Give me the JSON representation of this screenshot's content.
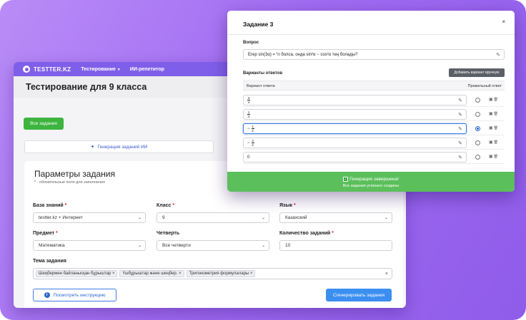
{
  "app": {
    "brand": "TESTTER.KZ",
    "nav": [
      {
        "label": "Тестирование",
        "has_caret": true
      },
      {
        "label": "ИИ-репетитор",
        "has_caret": false
      }
    ],
    "page_title": "Тестирование для 9 класса",
    "all_tasks_button": "Все задания",
    "ai_generation_tab": "Генерация заданий ИИ"
  },
  "params": {
    "title": "Параметры задания",
    "required_note": "* - обязательные поля для заполнения",
    "knowledge_base": {
      "label": "База знаний",
      "required": "*",
      "value": "testter.kz + Интернет"
    },
    "grade": {
      "label": "Класс",
      "required": "*",
      "value": "9"
    },
    "language": {
      "label": "Язык",
      "required": "*",
      "value": "Казахский"
    },
    "subject": {
      "label": "Предмет",
      "required": "*",
      "value": "Математика"
    },
    "quarter": {
      "label": "Четверть",
      "value": "Все четверти"
    },
    "count": {
      "label": "Количество заданий",
      "required": "*",
      "value": "10"
    },
    "topic": {
      "label": "Тема задания",
      "tags": [
        "Шеңбермен байланысқан бұрыштар",
        "Үшбұрыштар және шеңбер.",
        "Тригонометрия формулалары"
      ]
    },
    "instruction_button": "Посмотреть инструкцию",
    "generate_button": "Сгенерировать задания"
  },
  "modal": {
    "title": "Задание 3",
    "close": "×",
    "question_label": "Вопрос",
    "question_text": "Егер sin(3α) = ½ болса, онда sin²α − cos²α тең болады?",
    "answers_label": "Варианты ответов",
    "add_manual_button": "Добавить вариант вручную",
    "col_answer": "Вариант ответа",
    "col_correct": "Правильный ответ",
    "answers": [
      {
        "prefix": "",
        "num": "3",
        "den": "4",
        "text": "",
        "correct": false
      },
      {
        "prefix": "",
        "num": "1",
        "den": "4",
        "text": "",
        "correct": false
      },
      {
        "prefix": "−",
        "num": "1",
        "den": "2",
        "text": "",
        "correct": true
      },
      {
        "prefix": "−",
        "num": "3",
        "den": "4",
        "text": "",
        "correct": false
      },
      {
        "prefix": "",
        "num": "",
        "den": "",
        "text": "0",
        "correct": false
      }
    ],
    "toast_title": "Генерация завершена!",
    "toast_sub": "Все задания успешно созданы"
  },
  "colors": {
    "nav": "#7f5fe9",
    "green": "#3cb43e",
    "blue": "#3b8ff0",
    "toast": "#5bbf5b"
  }
}
